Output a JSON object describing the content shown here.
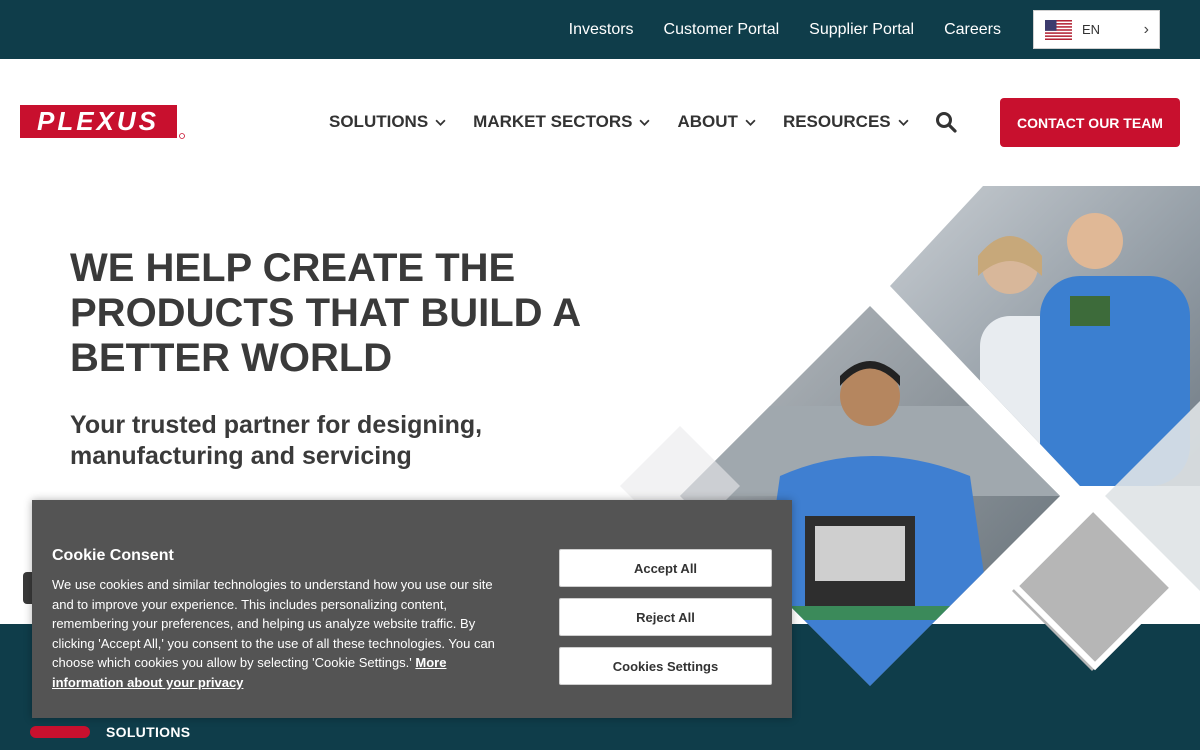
{
  "topbar": {
    "links": [
      "Investors",
      "Customer Portal",
      "Supplier Portal",
      "Careers"
    ],
    "language": "EN"
  },
  "header": {
    "logo_text": "PLEXUS",
    "nav": [
      "SOLUTIONS",
      "MARKET SECTORS",
      "ABOUT",
      "RESOURCES"
    ],
    "contact_label": "CONTACT OUR TEAM"
  },
  "hero": {
    "title": "WE HELP CREATE THE PRODUCTS THAT BUILD A BETTER WORLD",
    "subtitle": "Your trusted partner for designing, manufacturing and servicing"
  },
  "lower": {
    "section_label": "SOLUTIONS"
  },
  "cookie": {
    "title": "Cookie Consent",
    "body": "We use cookies and similar technologies to understand how you use our site and to improve your experience. This includes personalizing content, remembering your preferences, and helping us analyze website traffic. By clicking 'Accept All,' you consent to the use of all these technologies. You can choose which cookies you allow by selecting 'Cookie Settings.'",
    "link": "More information about your privacy",
    "accept": "Accept All",
    "reject": "Reject All",
    "settings": "Cookies Settings"
  },
  "colors": {
    "brand_red": "#c8102e",
    "teal_dark": "#0f3d4a",
    "text_dark": "#3a3a3a",
    "cookie_bg": "#545454"
  }
}
